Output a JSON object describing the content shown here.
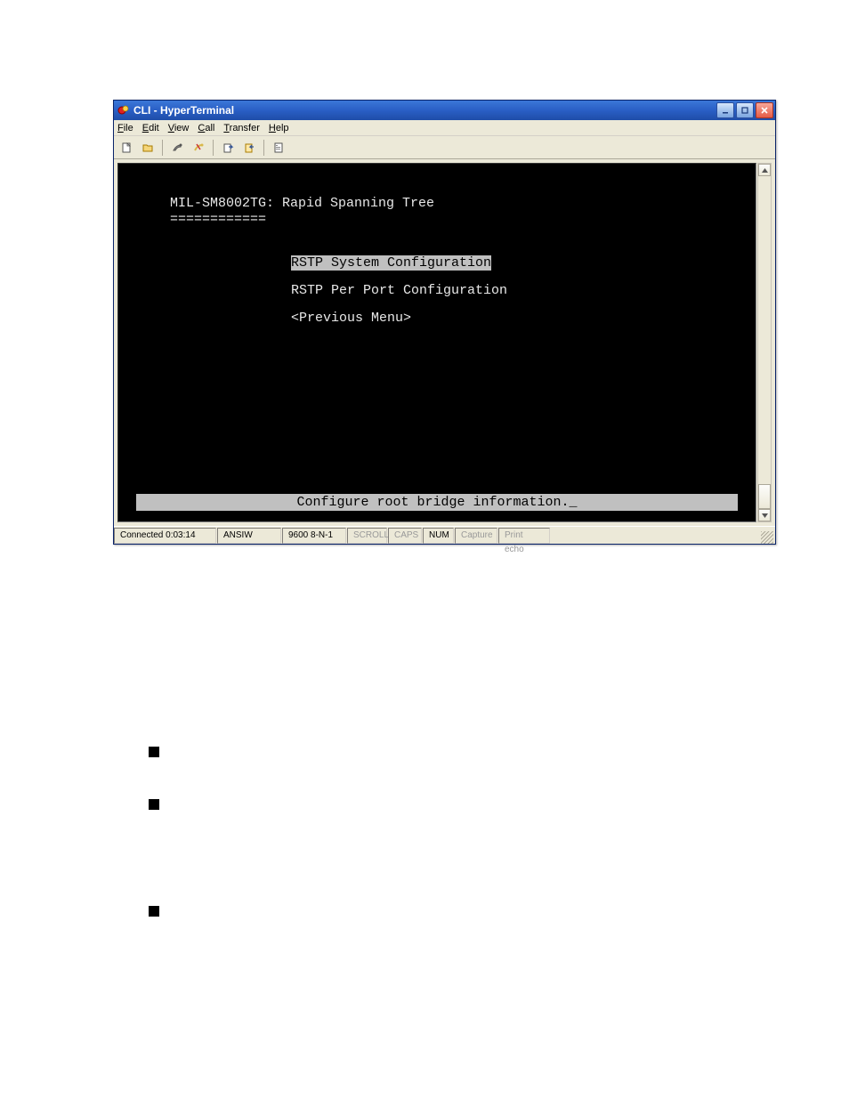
{
  "window": {
    "title": "CLI - HyperTerminal"
  },
  "menubar": {
    "items": [
      {
        "label": "File",
        "accel": "F"
      },
      {
        "label": "Edit",
        "accel": "E"
      },
      {
        "label": "View",
        "accel": "V"
      },
      {
        "label": "Call",
        "accel": "C"
      },
      {
        "label": "Transfer",
        "accel": "T"
      },
      {
        "label": "Help",
        "accel": "H"
      }
    ]
  },
  "toolbar": {
    "icons": [
      "new-file-icon",
      "open-file-icon",
      "connect-icon",
      "disconnect-icon",
      "send-icon",
      "receive-icon",
      "properties-icon"
    ]
  },
  "terminal": {
    "header": "MIL-SM8002TG: Rapid Spanning Tree",
    "underline": "============",
    "menu": [
      {
        "label": "RSTP System Configuration",
        "selected": true
      },
      {
        "label": "RSTP Per Port Configuration",
        "selected": false
      },
      {
        "label": "<Previous Menu>",
        "selected": false
      }
    ],
    "status": "Configure root bridge information."
  },
  "statusbar": {
    "connected": "Connected 0:03:14",
    "emulation": "ANSIW",
    "settings": "9600 8-N-1",
    "scroll": "SCROLL",
    "caps": "CAPS",
    "num": "NUM",
    "capture": "Capture",
    "printecho": "Print echo"
  }
}
